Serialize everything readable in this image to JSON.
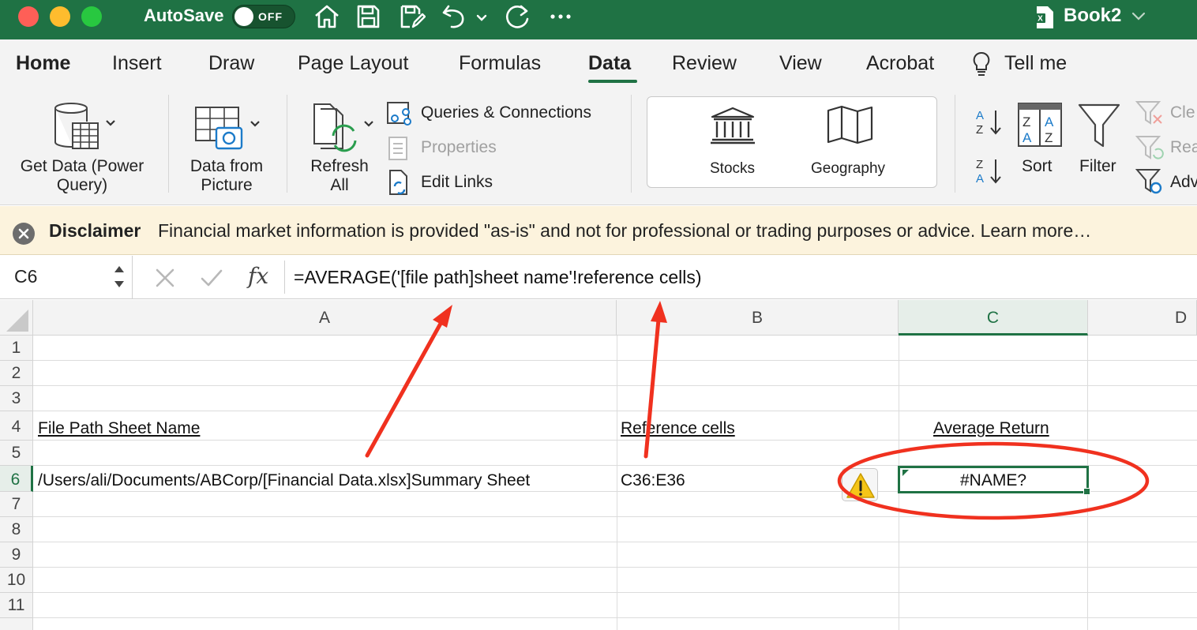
{
  "window": {
    "autosave_label": "AutoSave",
    "autosave_state": "OFF",
    "title": "Book2"
  },
  "tabs": [
    {
      "label": "Home"
    },
    {
      "label": "Insert"
    },
    {
      "label": "Draw"
    },
    {
      "label": "Page Layout"
    },
    {
      "label": "Formulas"
    },
    {
      "label": "Data"
    },
    {
      "label": "Review"
    },
    {
      "label": "View"
    },
    {
      "label": "Acrobat"
    },
    {
      "label": "Tell me"
    }
  ],
  "ribbon": {
    "get_data": "Get Data (Power Query)",
    "data_from_picture": "Data from Picture",
    "refresh_all": "Refresh All",
    "queries_connections": "Queries & Connections",
    "properties": "Properties",
    "edit_links": "Edit Links",
    "stocks": "Stocks",
    "geography": "Geography",
    "sort": "Sort",
    "filter": "Filter",
    "clear_partial": "Cle",
    "reapply_partial": "Rea",
    "advanced_partial": "Adv"
  },
  "disclaimer": {
    "title": "Disclaimer",
    "text": "Financial market information is provided \"as-is\" and not for professional or trading purposes or advice. Learn more…"
  },
  "formula_bar": {
    "name_box": "C6",
    "fx_label": "fx",
    "formula": "=AVERAGE('[file path]sheet name'!reference cells)"
  },
  "columns": [
    "A",
    "B",
    "C",
    "D"
  ],
  "rows": [
    "1",
    "2",
    "3",
    "4",
    "5",
    "6",
    "7",
    "8",
    "9",
    "10",
    "11"
  ],
  "cells": {
    "A4": "File Path Sheet Name",
    "B4": "Reference cells",
    "C4": "Average Return",
    "A6": "/Users/ali/Documents/ABCorp/[Financial Data.xlsx]Summary Sheet",
    "B6": "C36:E36",
    "C6": "#NAME?"
  },
  "colors": {
    "excel_green": "#1f7244",
    "annotation_red": "#f0311f",
    "disclaimer_bg": "#fcf3dd"
  }
}
